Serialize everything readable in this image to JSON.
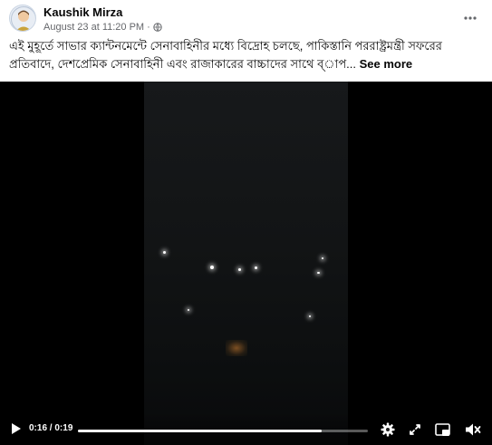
{
  "post": {
    "author_name": "Kaushik Mirza",
    "timestamp": "August 23 at 11:20 PM",
    "separator": "·",
    "privacy_icon": "globe-icon",
    "more_icon": "more-options-icon",
    "text": "এই মুহূর্তে সাভার ক্যান্টনমেন্টে সেনাবাহিনীর মধ্যে বিদ্রোহ চলছে, পাকিস্তানি পররাষ্ট্রমন্ত্রী সফরের প্রতিবাদে, দেশপ্রেমিক সেনাবাহিনী এবং রাজাকারের বাচ্চাদের সাথে ব্াপ...",
    "see_more_label": "See more"
  },
  "video": {
    "current_time": "0:16",
    "time_separator": "/",
    "duration": "0:19",
    "progress_fraction": 0.84,
    "icons": [
      "play-icon",
      "settings-icon",
      "fullscreen-icon",
      "picture-in-picture-icon",
      "volume-muted-icon"
    ]
  },
  "colors": {
    "secondary_text": "#65676b",
    "video_bg": "#000000"
  }
}
